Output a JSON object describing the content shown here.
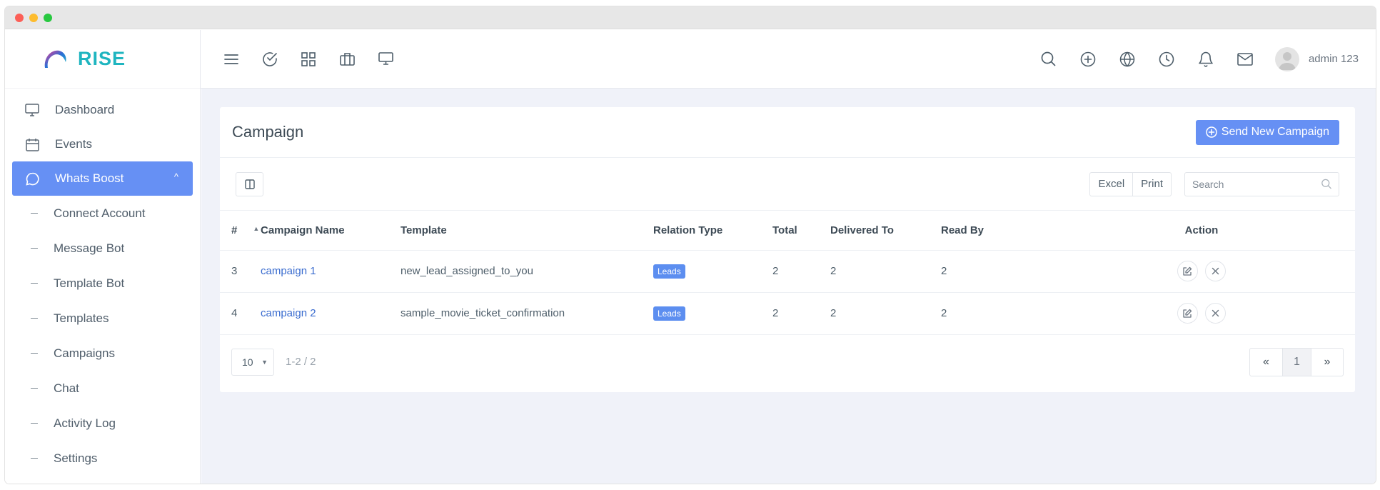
{
  "brand": {
    "name": "RISE"
  },
  "sidebar": {
    "items": [
      {
        "label": "Dashboard",
        "icon": "monitor-icon"
      },
      {
        "label": "Events",
        "icon": "calendar-icon"
      },
      {
        "label": "Whats Boost",
        "icon": "chat-bubble-icon",
        "active": true
      }
    ],
    "sub_items": [
      {
        "label": "Connect Account"
      },
      {
        "label": "Message Bot"
      },
      {
        "label": "Template Bot"
      },
      {
        "label": "Templates"
      },
      {
        "label": "Campaigns"
      },
      {
        "label": "Chat"
      },
      {
        "label": "Activity Log"
      },
      {
        "label": "Settings"
      }
    ]
  },
  "topbar": {
    "left_icons": [
      "menu-icon",
      "check-circle-icon",
      "grid-icon",
      "briefcase-icon",
      "monitor-icon"
    ],
    "right_icons": [
      "search-icon",
      "plus-circle-icon",
      "globe-icon",
      "clock-icon",
      "bell-icon",
      "mail-icon"
    ],
    "user_name": "admin 123"
  },
  "page": {
    "title": "Campaign",
    "primary_button": "Send New Campaign",
    "export_buttons": [
      "Excel",
      "Print"
    ],
    "search_placeholder": "Search"
  },
  "table": {
    "columns": [
      "#",
      "Campaign Name",
      "Template",
      "Relation Type",
      "Total",
      "Delivered To",
      "Read By",
      "Action"
    ],
    "rows": [
      {
        "id": "3",
        "name": "campaign 1",
        "template": "new_lead_assigned_to_you",
        "relation": "Leads",
        "total": "2",
        "delivered": "2",
        "read": "2"
      },
      {
        "id": "4",
        "name": "campaign 2",
        "template": "sample_movie_ticket_confirmation",
        "relation": "Leads",
        "total": "2",
        "delivered": "2",
        "read": "2"
      }
    ]
  },
  "pagination": {
    "page_size": "10",
    "range": "1-2 / 2",
    "prev": "«",
    "current": "1",
    "next": "»"
  },
  "colors": {
    "accent": "#6690f4",
    "brand": "#1fb5c0",
    "background": "#f0f2f9",
    "link": "#3a6ccf"
  }
}
